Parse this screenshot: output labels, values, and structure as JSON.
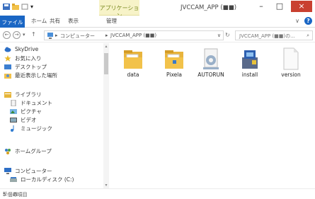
{
  "window": {
    "title": "JVCCAM_APP (■■)",
    "context_tab": "アプリケーション",
    "quick_access": "▾"
  },
  "ribbon": {
    "tabs": [
      "ファイル",
      "ホーム",
      "共有",
      "表示",
      "管理"
    ],
    "expand": "∨",
    "help": "?"
  },
  "address": {
    "back": "←",
    "forward": "→",
    "history": "▾",
    "up": "↑",
    "path": [
      "▸",
      "コンピューター",
      "▸",
      "JVCCAM_APP (■■)"
    ],
    "dropdown": "∨",
    "refresh": "↻",
    "search_placeholder": "JVCCAM_APP (■■)の...",
    "search_icon": "⌕"
  },
  "nav": {
    "items": [
      {
        "label": "SkyDrive",
        "icon": "cloud-icon",
        "sub": false
      },
      {
        "label": "お気に入り",
        "icon": "star-icon",
        "sub": false
      },
      {
        "label": "デスクトップ",
        "icon": "desktop-icon",
        "sub": false
      },
      {
        "label": "最近表示した場所",
        "icon": "recent-icon",
        "sub": false
      },
      {
        "label": "ライブラリ",
        "icon": "library-icon",
        "sub": false
      },
      {
        "label": "ドキュメント",
        "icon": "documents-icon",
        "sub": true
      },
      {
        "label": "ピクチャ",
        "icon": "pictures-icon",
        "sub": true
      },
      {
        "label": "ビデオ",
        "icon": "videos-icon",
        "sub": true
      },
      {
        "label": "ミュージック",
        "icon": "music-icon",
        "sub": true
      },
      {
        "label": "ホームグループ",
        "icon": "homegroup-icon",
        "sub": false
      },
      {
        "label": "コンピューター",
        "icon": "computer-icon",
        "sub": false
      },
      {
        "label": "ローカルディスク (C:)",
        "icon": "disk-icon",
        "sub": true
      }
    ],
    "scroll_up": "▴",
    "scroll_down": "▾"
  },
  "files": [
    {
      "name": "data",
      "icon": "folder-icon"
    },
    {
      "name": "Pixela",
      "icon": "folder-icon"
    },
    {
      "name": "AUTORUN",
      "icon": "settings-file-icon"
    },
    {
      "name": "install",
      "icon": "installer-icon"
    },
    {
      "name": "version",
      "icon": "file-icon"
    }
  ],
  "status": {
    "text": "5 個の項目",
    "view_icons": "☷ ▤"
  },
  "colors": {
    "file_tab": "#1a66c4",
    "context_tab": "#f7f3c8",
    "close_button": "#c94030",
    "folder": "#f2c24a"
  }
}
